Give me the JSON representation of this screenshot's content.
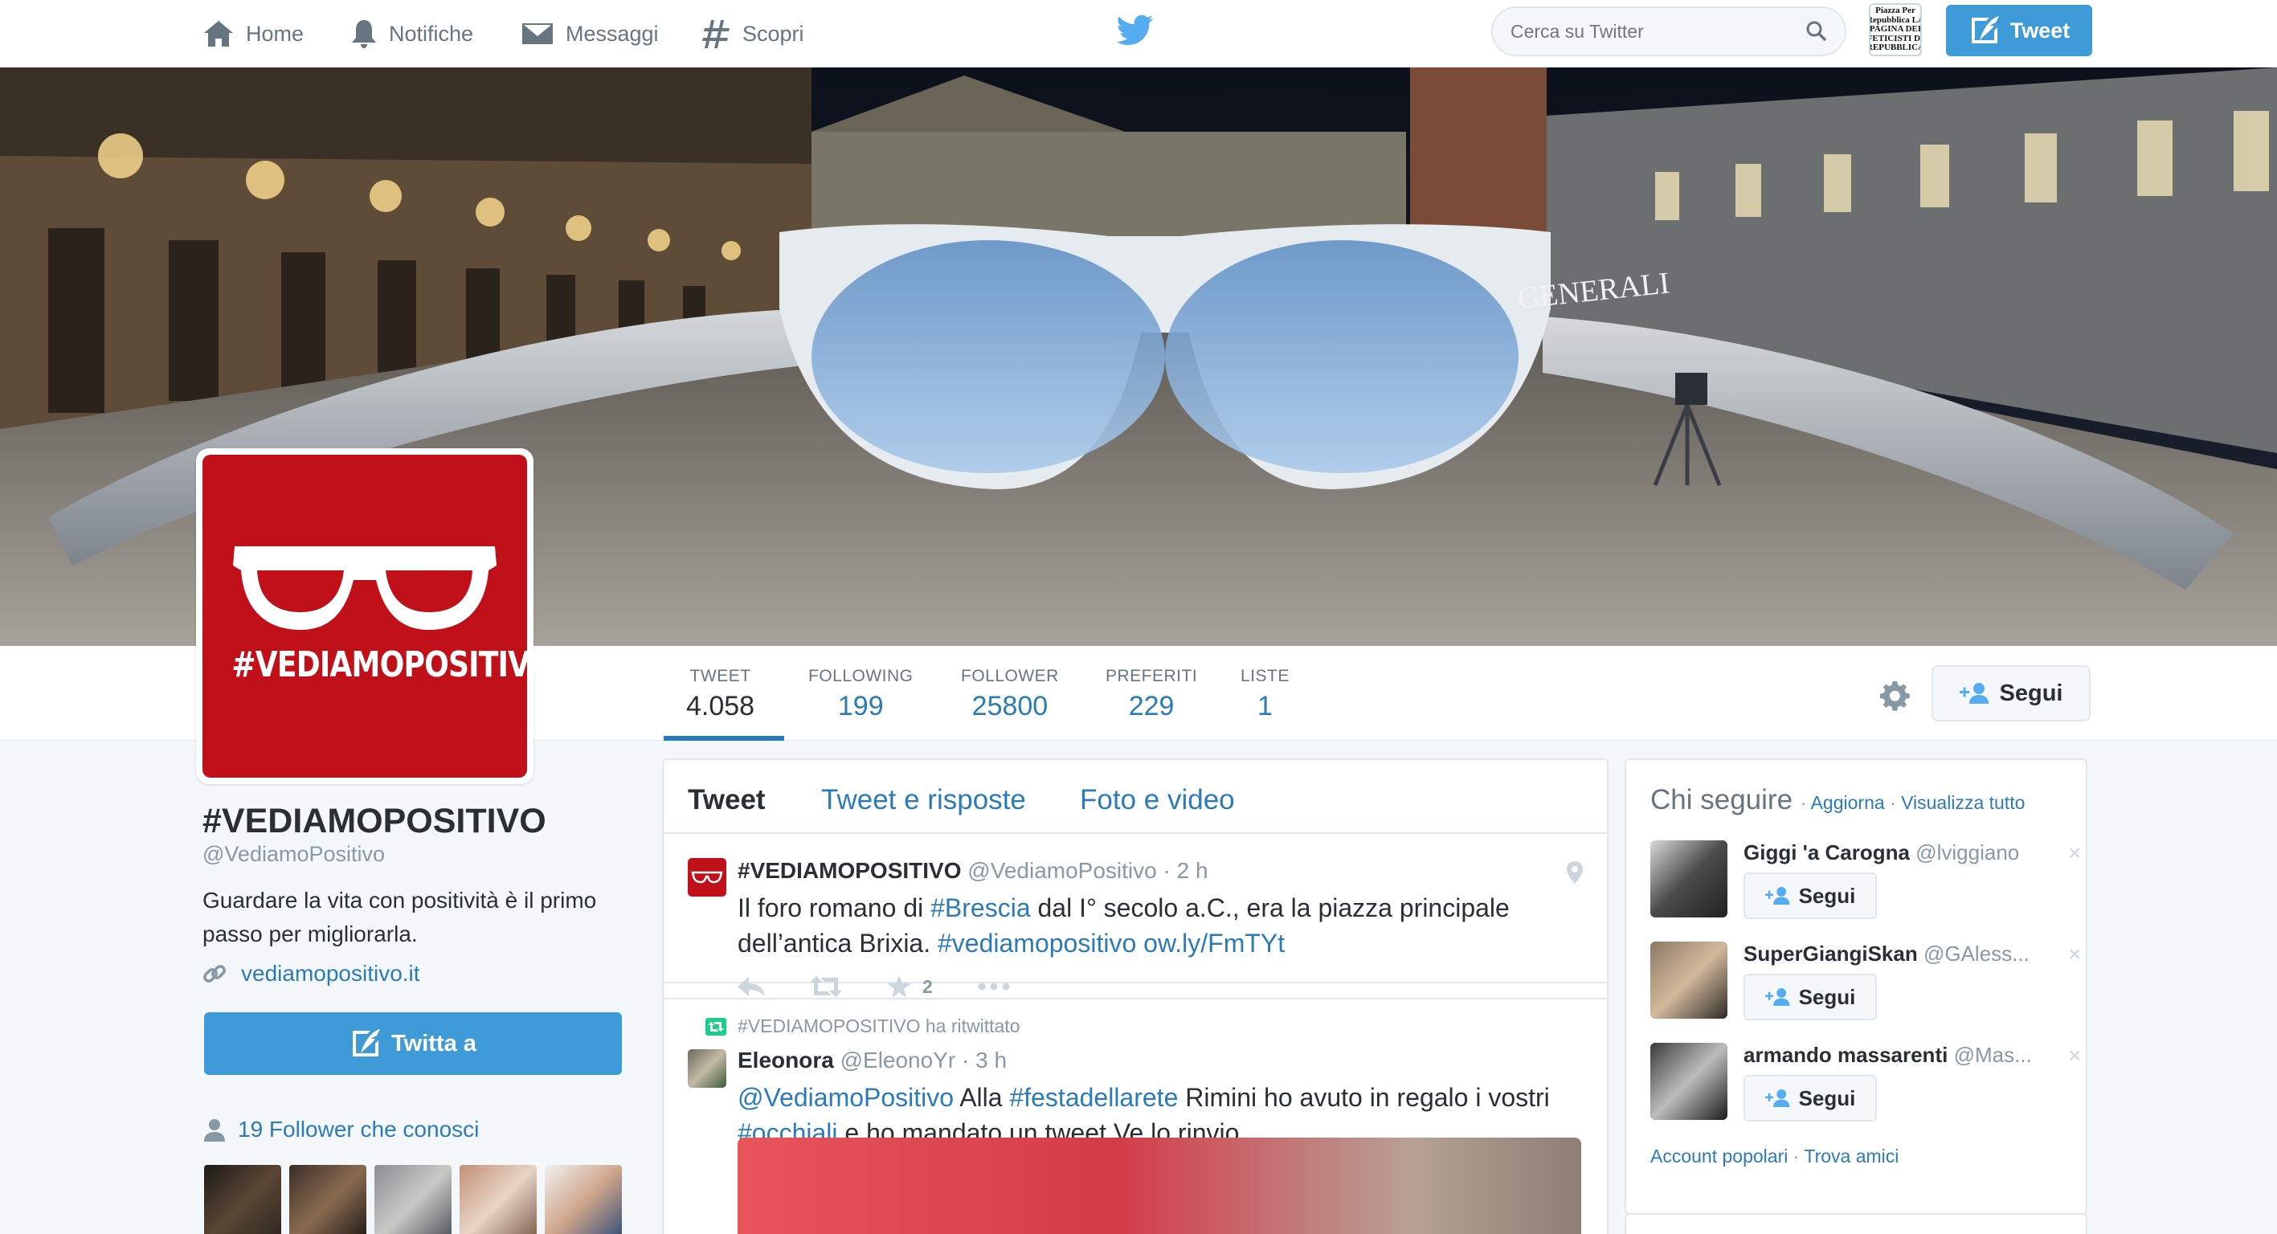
{
  "nav": {
    "home": "Home",
    "notifications": "Notifiche",
    "messages": "Messaggi",
    "discover": "Scopri",
    "search_placeholder": "Cerca su Twitter",
    "avatar_text": "Piazza Per Repubblica LA PAGINA DEI FETICISTI DI REPUBBLICA",
    "tweet_button": "Tweet"
  },
  "banner": {
    "glasses_brand": "GENERALI"
  },
  "stats": [
    {
      "label": "TWEET",
      "value": "4.058"
    },
    {
      "label": "FOLLOWING",
      "value": "199"
    },
    {
      "label": "FOLLOWER",
      "value": "25800"
    },
    {
      "label": "PREFERITI",
      "value": "229"
    },
    {
      "label": "LISTE",
      "value": "1"
    }
  ],
  "follow_button": "Segui",
  "profile": {
    "avatar_text": "#VEDIAMOPOSITIVO",
    "name": "#VEDIAMOPOSITIVO",
    "handle": "@VediamoPositivo",
    "bio": "Guardare la vita con positività è il primo passo per migliorarla.",
    "website": "vediamopositivo.it",
    "tweet_to": "Twitta a",
    "followers_you_know": "19 Follower che conosci"
  },
  "timeline": {
    "tabs": [
      "Tweet",
      "Tweet e risposte",
      "Foto e video"
    ],
    "tweet1": {
      "name": "#VEDIAMOPOSITIVO",
      "handle": "@VediamoPositivo",
      "time": "· 2 h",
      "text_1": "Il foro romano di ",
      "hashtag_1": "#Brescia",
      "text_2": " dal I° secolo a.C., era la piazza principale dell’antica Brixia. ",
      "hashtag_2": "#vediamopositivo",
      "link": " ow.ly/FmTYt",
      "favorites": "2"
    },
    "tweet2": {
      "retweeted_by": "#VEDIAMOPOSITIVO ha ritwittato",
      "name": "Eleonora",
      "handle": "@EleonoYr",
      "time": "· 3 h",
      "mention": "@VediamoPositivo",
      "text_1": " Alla ",
      "hashtag_1": "#festadellarete",
      "text_2": " Rimini ho avuto in regalo i vostri ",
      "hashtag_2": "#occhiali",
      "text_3": " e ho mandato un tweet.Ve lo rinvio"
    }
  },
  "who_to_follow": {
    "title": "Chi seguire",
    "refresh": "Aggiorna",
    "view_all": "Visualizza tutto",
    "suggestions": [
      {
        "name": "Giggi 'a Carogna",
        "handle": "@lviggiano",
        "button": "Segui"
      },
      {
        "name": "SuperGiangiSkan",
        "handle": "@GAless...",
        "button": "Segui"
      },
      {
        "name": "armando massarenti",
        "handle": "@Mas...",
        "button": "Segui"
      }
    ],
    "popular": "Account popolari",
    "find_friends": "Trova amici"
  },
  "colors": {
    "accent": "#2b7bb9",
    "button_blue": "#3f9bd8",
    "brand_red": "#c0101a"
  }
}
